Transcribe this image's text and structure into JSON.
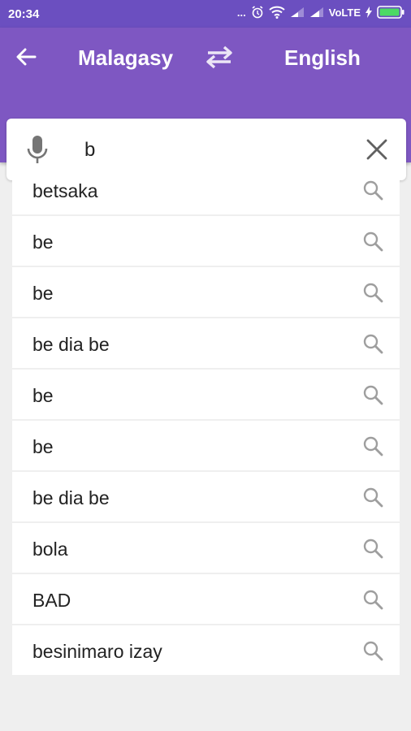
{
  "status": {
    "time": "20:34",
    "dots": "...",
    "network": "VoLTE"
  },
  "toolbar": {
    "source_language": "Malagasy",
    "target_language": "English"
  },
  "search": {
    "value": "b",
    "placeholder": ""
  },
  "results": [
    {
      "label": "betsaka"
    },
    {
      "label": "be"
    },
    {
      "label": "be"
    },
    {
      "label": "be dia be"
    },
    {
      "label": "be"
    },
    {
      "label": "be"
    },
    {
      "label": "be dia be"
    },
    {
      "label": "bola"
    },
    {
      "label": "BAD"
    },
    {
      "label": "besinimaro izay"
    }
  ],
  "colors": {
    "toolbar": "#7e57c2",
    "status_bar": "#6b4fc0",
    "background": "#efefef"
  }
}
